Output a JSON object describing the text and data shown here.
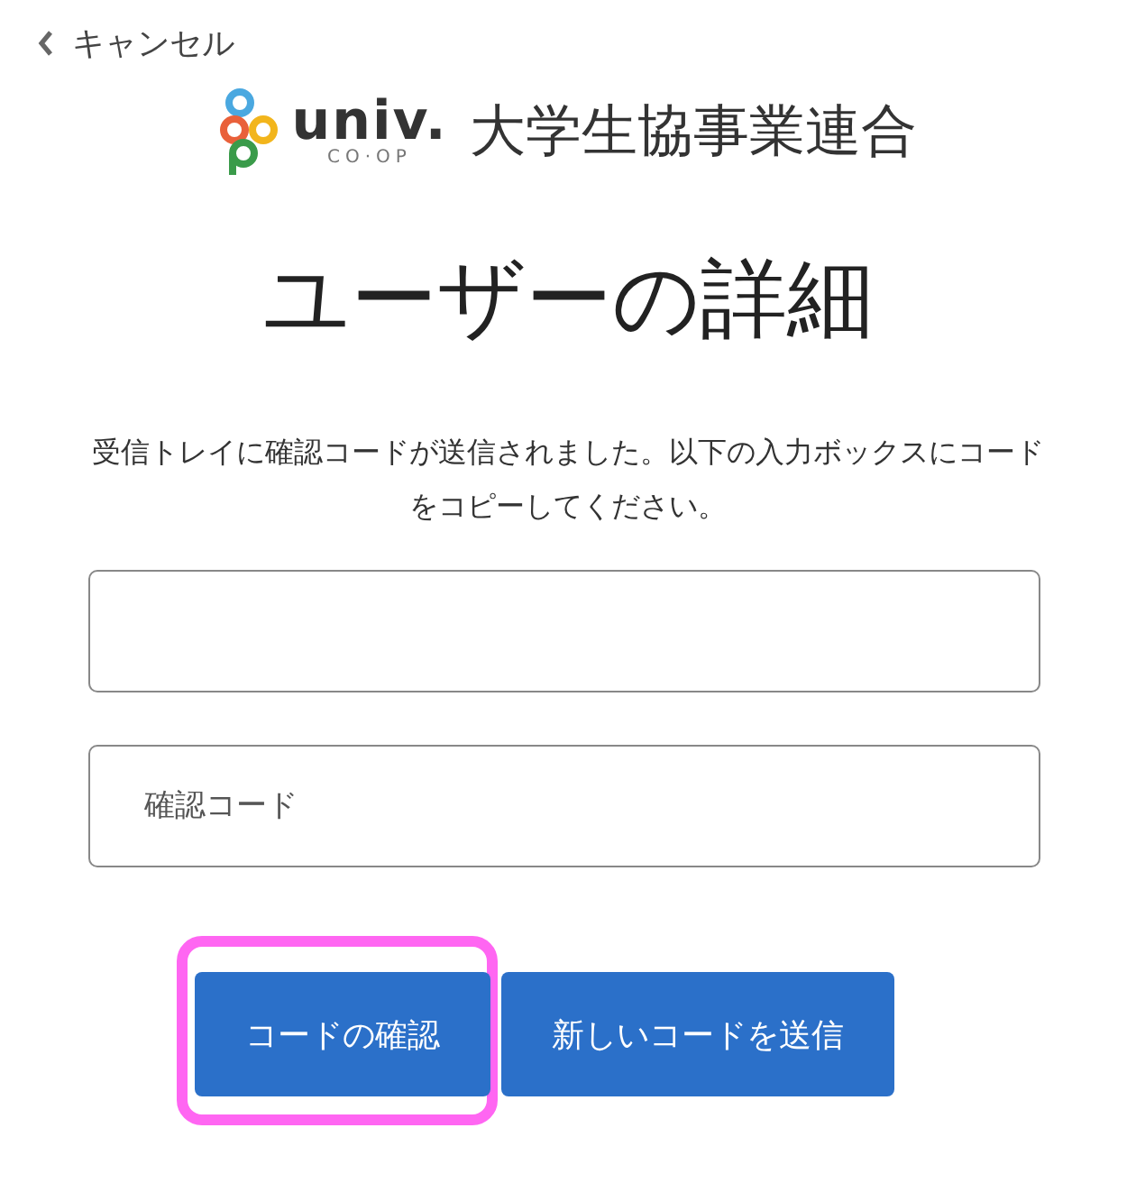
{
  "cancel_link": {
    "label": "キャンセル"
  },
  "logo": {
    "brand": "univ.",
    "sub": "CO·OP",
    "name": "大学生協事業連合"
  },
  "title": "ユーザーの詳細",
  "message": "受信トレイに確認コードが送信されました。以下の入力ボックスにコードをコピーしてください。",
  "fields": [
    {
      "kind": "blank"
    },
    {
      "kind": "hint",
      "placeholder": "確認コード"
    }
  ],
  "buttons": [
    {
      "label": "コードの確認",
      "highlighted": true
    },
    {
      "label": "新しいコードを送信",
      "highlighted": false
    }
  ]
}
